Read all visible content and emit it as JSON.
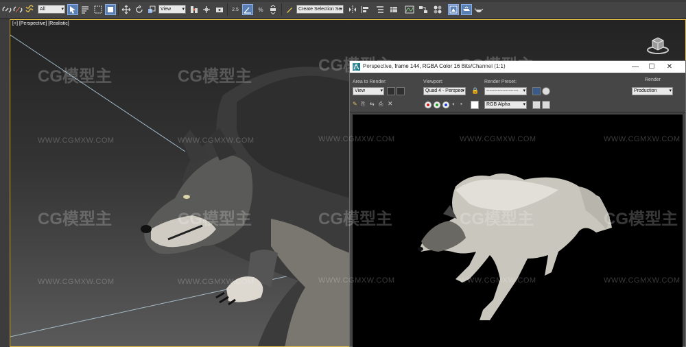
{
  "toolbar": {
    "selection_filter": "All",
    "reference_coord": "View",
    "snap_label": "2.5",
    "percent_snap": "%",
    "named_selection_placeholder": "Create Selection Se"
  },
  "viewport": {
    "label_plus": "[+]",
    "label_view": "[Perspective]",
    "label_shading": "[Realistic]"
  },
  "render_window": {
    "title": "Perspective, frame 144, RGBA Color 16 Bits/Channel (1:1)",
    "area_to_render_label": "Area to Render:",
    "area_to_render_value": "View",
    "viewport_label": "Viewport:",
    "viewport_value": "Quad 4 - Perspec",
    "render_preset_label": "Render Preset:",
    "render_preset_value": "--------------------",
    "render_button": "Render",
    "render_mode_value": "Production",
    "channel_value": "RGB Alpha"
  },
  "watermarks": {
    "logo": "CG模型主",
    "url": "WWW.CGMXW.COM"
  },
  "colors": {
    "viewport_border": "#e8c14a",
    "active_button": "#5a7fb5",
    "toolbar_bg": "#444444"
  }
}
